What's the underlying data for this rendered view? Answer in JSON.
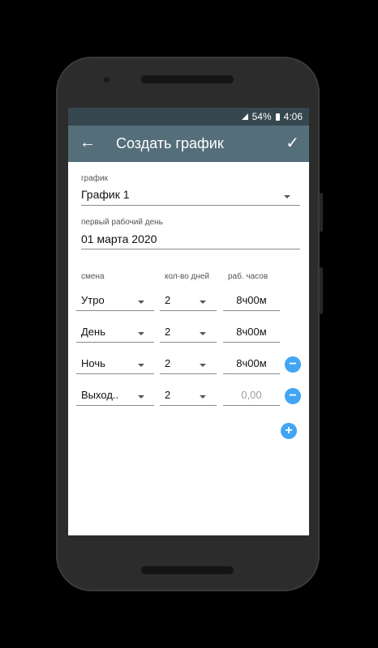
{
  "status": {
    "battery": "54%",
    "time": "4:06"
  },
  "appbar": {
    "back_icon": "arrow-back-icon",
    "title": "Создать график",
    "check_icon": "check-icon"
  },
  "form": {
    "schedule_label": "график",
    "schedule_value": "График 1",
    "first_day_label": "первый рабочий день",
    "first_day_value": "01 марта 2020"
  },
  "table": {
    "headers": {
      "shift": "смена",
      "days": "кол-во дней",
      "hours": "раб. часов"
    },
    "rows": [
      {
        "shift": "Утро",
        "days": "2",
        "hours": "8ч00м",
        "removable": false
      },
      {
        "shift": "День",
        "days": "2",
        "hours": "8ч00м",
        "removable": false
      },
      {
        "shift": "Ночь",
        "days": "2",
        "hours": "8ч00м",
        "removable": true
      },
      {
        "shift": "Выход..",
        "days": "2",
        "hours": "0,00",
        "hours_is_placeholder": true,
        "removable": true
      }
    ]
  },
  "colors": {
    "appbar": "#546e7a",
    "statusbar": "#37474f",
    "accent": "#42a5f5"
  }
}
